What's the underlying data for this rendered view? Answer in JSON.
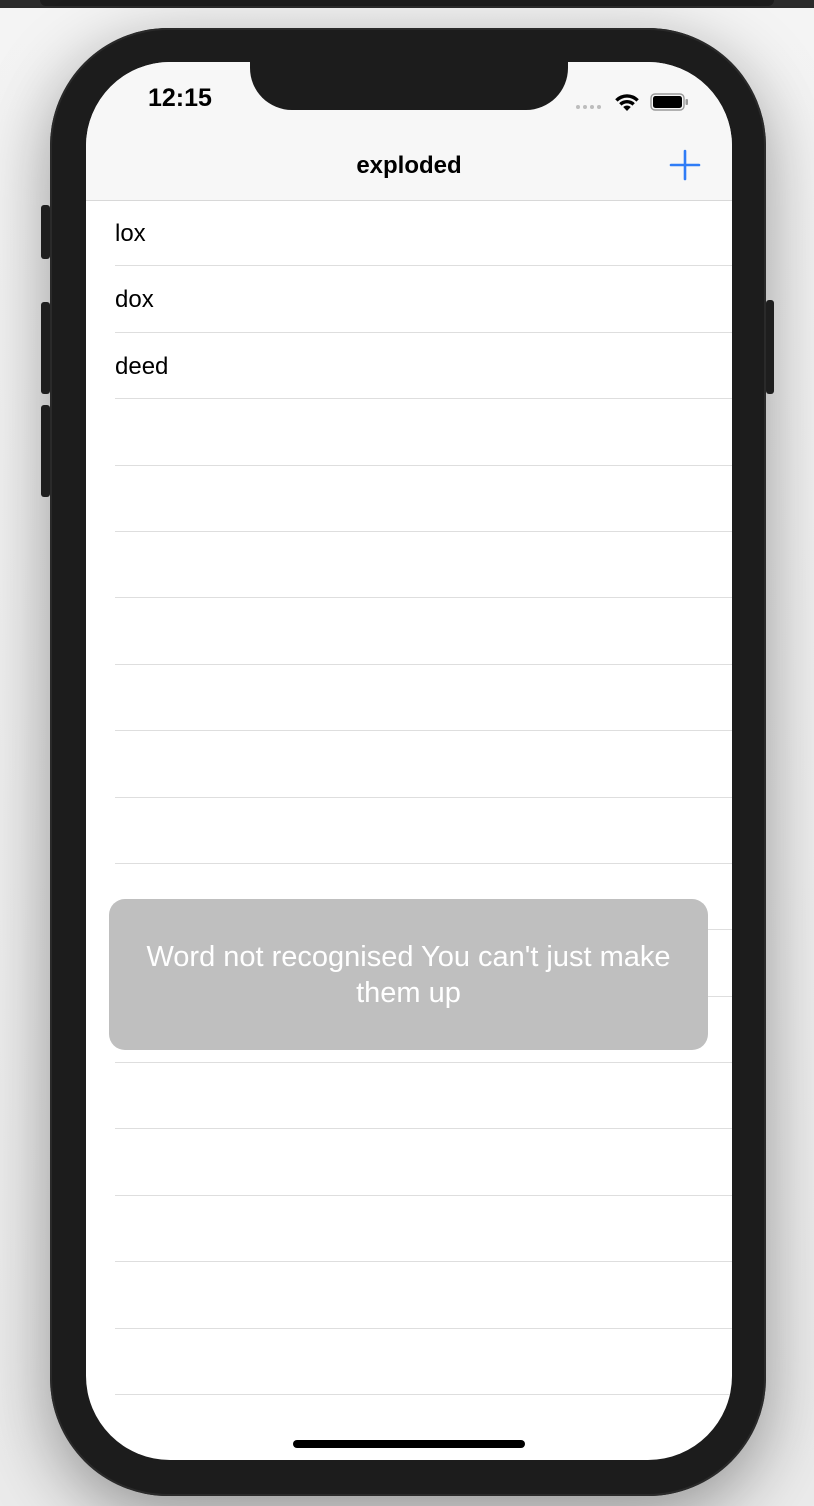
{
  "status_bar": {
    "time": "12:15"
  },
  "nav": {
    "title": "exploded"
  },
  "words": [
    "lox",
    "dox",
    "deed",
    "",
    "",
    "",
    "",
    "",
    "",
    "",
    "",
    "",
    "",
    "",
    "",
    "",
    "",
    ""
  ],
  "toast": {
    "message": "Word not recognised You can't just make them up"
  },
  "colors": {
    "accent": "#2f7cf6",
    "toast_bg": "#bfbfbf",
    "nav_bg": "#f7f7f7",
    "separator": "#dedede"
  }
}
